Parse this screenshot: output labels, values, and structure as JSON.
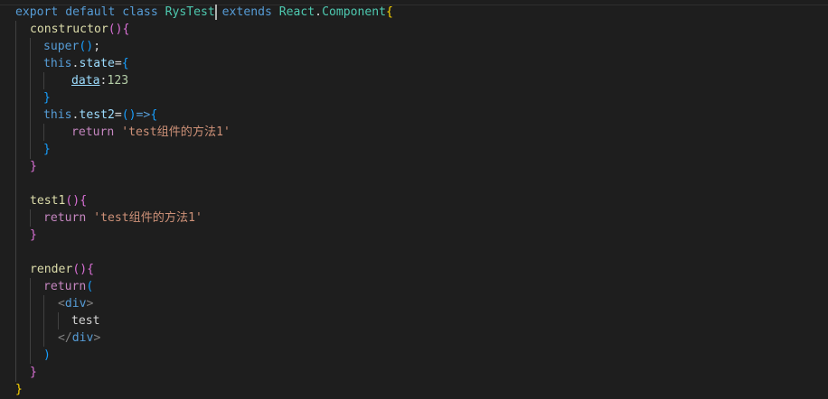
{
  "code": {
    "l1": {
      "export": "export",
      "default": "default",
      "class": "class",
      "name": "RysTest",
      "extends": "extends",
      "react": "React",
      "dot": ".",
      "component": "Component",
      "brace": "{"
    },
    "l2": {
      "fn": "constructor",
      "paren": "()",
      "brace": "{"
    },
    "l3": {
      "super": "super",
      "paren": "()",
      "semi": ";"
    },
    "l4": {
      "this": "this",
      "dot": ".",
      "prop": "state",
      "eq": "=",
      "brace": "{"
    },
    "l5": {
      "key": "data",
      "colon": ":",
      "value": "123"
    },
    "l6": {
      "brace": "}"
    },
    "l7": {
      "this": "this",
      "dot": ".",
      "prop": "test2",
      "eq": "=",
      "paren": "()",
      "arrow": "=>",
      "brace": "{"
    },
    "l8": {
      "ret": "return",
      "str": "'test组件的方法1'"
    },
    "l9": {
      "brace": "}"
    },
    "l10": {
      "brace": "}"
    },
    "l12": {
      "fn": "test1",
      "paren": "()",
      "brace": "{"
    },
    "l13": {
      "ret": "return",
      "str": "'test组件的方法1'"
    },
    "l14": {
      "brace": "}"
    },
    "l16": {
      "fn": "render",
      "paren": "()",
      "brace": "{"
    },
    "l17": {
      "ret": "return",
      "paren": "("
    },
    "l18": {
      "open": "<",
      "tag": "div",
      "close": ">"
    },
    "l19": {
      "text": "test"
    },
    "l20": {
      "open": "</",
      "tag": "div",
      "close": ">"
    },
    "l21": {
      "paren": ")"
    },
    "l22": {
      "brace": "}"
    },
    "l23": {
      "brace": "}"
    }
  },
  "colors": {
    "background": "#1e1e1e",
    "keyword": "#569cd6",
    "control_keyword": "#c586c0",
    "function": "#dcdcaa",
    "class": "#4ec9b0",
    "variable": "#9cdcfe",
    "string": "#ce9178",
    "number": "#b5cea8",
    "bracket_level1": "#ffd700",
    "bracket_level2": "#da70d6",
    "bracket_level3": "#179fff"
  }
}
